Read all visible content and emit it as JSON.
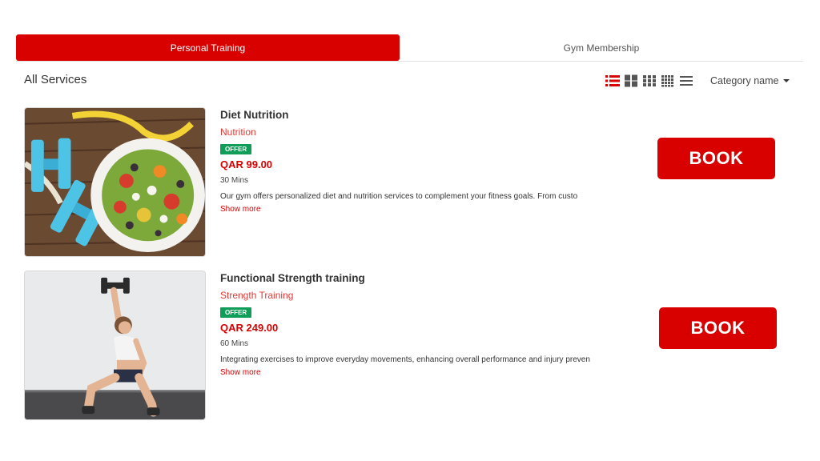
{
  "tabs": {
    "active_label": "Personal Training",
    "inactive_label": "Gym Membership"
  },
  "section": {
    "title": "All Services"
  },
  "view_options": {
    "icons": [
      "list-view-icon",
      "large-grid-view-icon",
      "grid-3-view-icon",
      "grid-4-view-icon",
      "compact-list-view-icon"
    ],
    "active": "list-view-icon"
  },
  "sort": {
    "label": "Category name"
  },
  "services": [
    {
      "title": "Diet Nutrition",
      "category": "Nutrition",
      "badge": "OFFER",
      "price": "QAR 99.00",
      "duration": "30 Mins",
      "description": "Our gym offers personalized diet and nutrition services to complement your fitness goals. From custo",
      "show_more": "Show more",
      "book_label": "BOOK",
      "image": "dumbbells-and-salad-image"
    },
    {
      "title": "Functional Strength training",
      "category": "Strength Training",
      "badge": "OFFER",
      "price": "QAR 249.00",
      "duration": "60 Mins",
      "description": "Integrating exercises to improve everyday movements, enhancing overall performance and injury preven",
      "show_more": "Show more",
      "book_label": "BOOK",
      "image": "woman-lunge-with-dumbbell-image"
    }
  ],
  "colors": {
    "accent": "#d90000",
    "category_text": "#e53935",
    "offer_badge": "#0f9d58"
  }
}
